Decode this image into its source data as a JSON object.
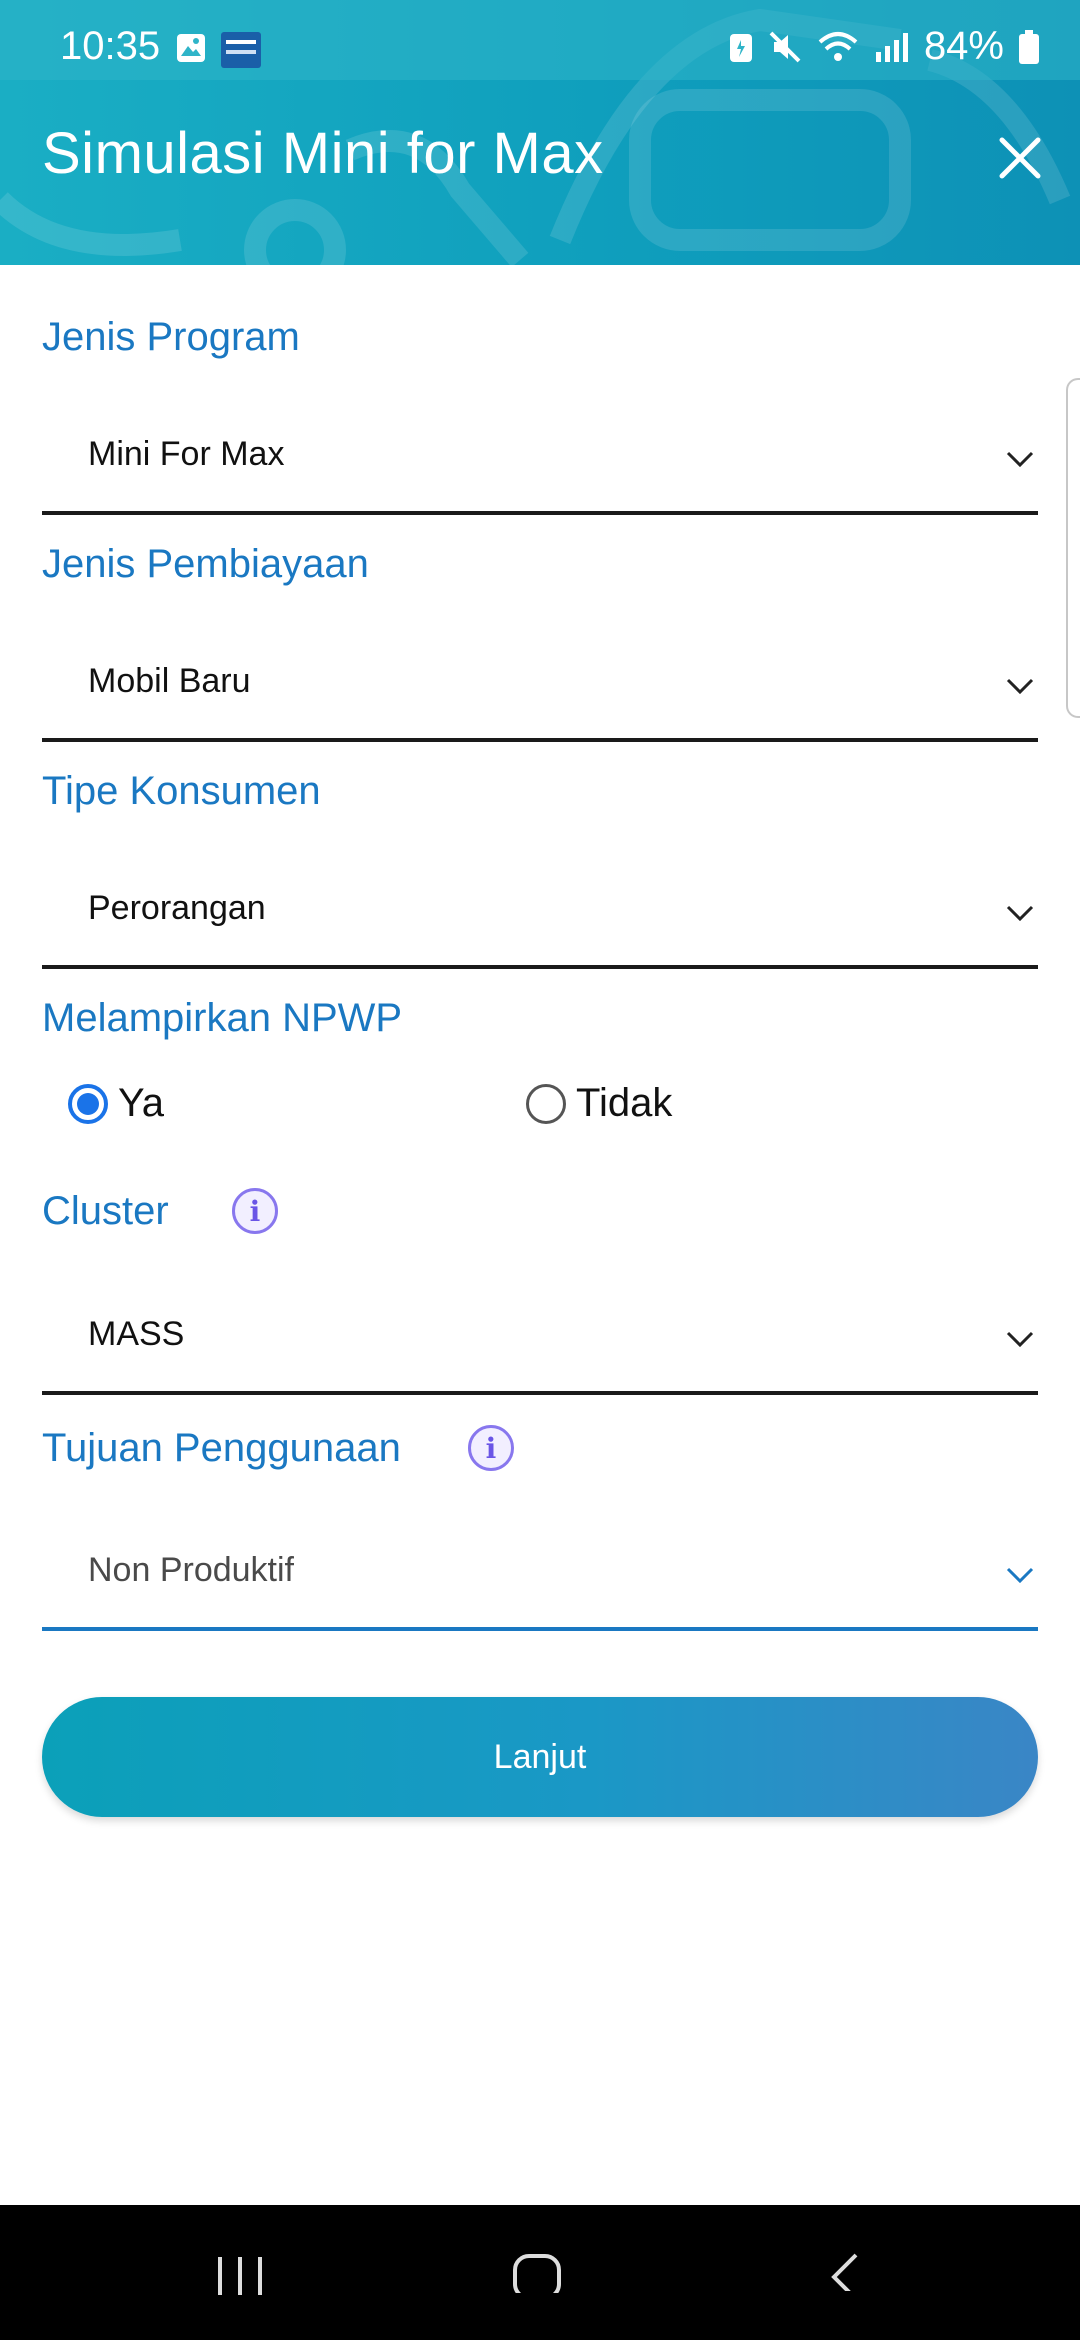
{
  "status_bar": {
    "time": "10:35",
    "battery_percent": "84%",
    "left_icons": [
      "image-icon",
      "news-app-icon"
    ],
    "right_icons": [
      "battery-saver-icon",
      "mute-icon",
      "wifi-icon",
      "signal-icon",
      "battery-icon"
    ]
  },
  "app_bar": {
    "title": "Simulasi Mini for Max",
    "close_icon": "close-icon"
  },
  "form": {
    "jenis_program": {
      "label": "Jenis Program",
      "value": "Mini For Max"
    },
    "jenis_pembiayaan": {
      "label": "Jenis Pembiayaan",
      "value": "Mobil Baru"
    },
    "tipe_konsumen": {
      "label": "Tipe Konsumen",
      "value": "Perorangan"
    },
    "npwp": {
      "label": "Melampirkan NPWP",
      "options": [
        {
          "label": "Ya",
          "selected": true
        },
        {
          "label": "Tidak",
          "selected": false
        }
      ]
    },
    "cluster": {
      "label": "Cluster",
      "value": "MASS"
    },
    "tujuan_penggunaan": {
      "label": "Tujuan Penggunaan",
      "value": "Non Produktif"
    }
  },
  "actions": {
    "submit_label": "Lanjut"
  },
  "colors": {
    "accent": "#1a78c2",
    "header": "#129fbd",
    "radio_selected": "#1a73e8",
    "info_icon": "#6a55e6"
  }
}
